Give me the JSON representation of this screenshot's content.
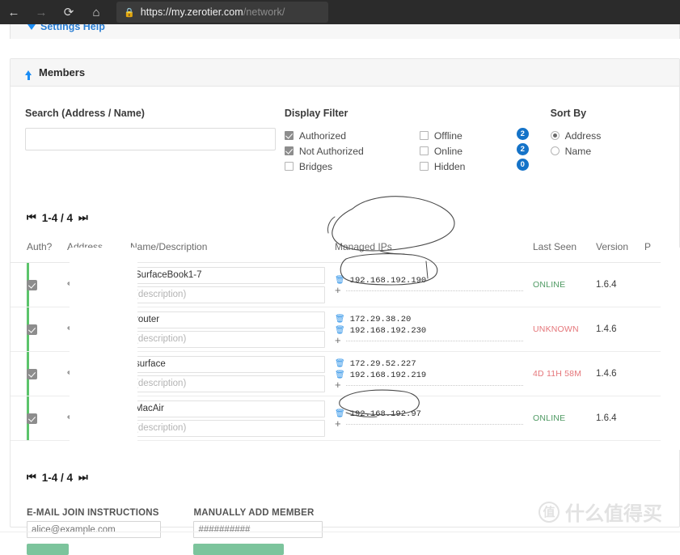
{
  "browser": {
    "back_icon": "←",
    "forward_icon": "→",
    "reload_icon": "⟳",
    "home_icon": "⌂",
    "lock_icon": "🔒",
    "url_host": "https://my.zerotier.com",
    "url_path": "/network/",
    "favorite_icon": "☆"
  },
  "settings_strip": {
    "help_label": "Settings Help"
  },
  "members": {
    "title": "Members"
  },
  "search": {
    "label": "Search (Address / Name)",
    "value": "",
    "placeholder": ""
  },
  "display_filter": {
    "title": "Display Filter",
    "options": [
      {
        "label": "Authorized",
        "checked": true
      },
      {
        "label": "Not Authorized",
        "checked": true
      },
      {
        "label": "Bridges",
        "checked": false
      }
    ],
    "status_options": [
      {
        "label": "Offline",
        "checked": false,
        "count": "2"
      },
      {
        "label": "Online",
        "checked": false,
        "count": "2"
      },
      {
        "label": "Hidden",
        "checked": false,
        "count": "0"
      }
    ]
  },
  "sort_by": {
    "title": "Sort By",
    "options": [
      {
        "label": "Address",
        "selected": true
      },
      {
        "label": "Name",
        "selected": false
      }
    ]
  },
  "pager": {
    "first_icon": "⏮",
    "last_icon": "⏭",
    "range": "1-4 / 4"
  },
  "table": {
    "headers": {
      "auth": "Auth?",
      "address": "Address",
      "name": "Name/Description",
      "ips": "Managed IPs",
      "last_seen": "Last Seen",
      "version": "Version",
      "physical": "P"
    },
    "rows": [
      {
        "authorized": true,
        "address": "",
        "name": "SurfaceBook1-7",
        "description_placeholder": "(description)",
        "ips": [
          "192.168.192.190"
        ],
        "last_seen": "ONLINE",
        "last_seen_state": "online",
        "version": "1.6.4"
      },
      {
        "authorized": true,
        "address": "",
        "name": "router",
        "description_placeholder": "(description)",
        "ips": [
          "172.29.38.20",
          "192.168.192.230"
        ],
        "last_seen": "UNKNOWN",
        "last_seen_state": "red",
        "version": "1.4.6"
      },
      {
        "authorized": true,
        "address": "",
        "name": "surface",
        "description_placeholder": "(description)",
        "ips": [
          "172.29.52.227",
          "192.168.192.219"
        ],
        "last_seen": "4D 11H 58M",
        "last_seen_state": "red",
        "version": "1.4.6"
      },
      {
        "authorized": true,
        "address": "",
        "name": "MacAir",
        "description_placeholder": "(description)",
        "ips": [
          "192.168.192.97"
        ],
        "last_seen": "ONLINE",
        "last_seen_state": "online",
        "version": "1.6.4"
      }
    ],
    "row_icons": {
      "delete_ip_icon": "🗑",
      "add_ip_icon": "+",
      "edit_icon": "✎"
    }
  },
  "footer_forms": {
    "email_join": {
      "label": "E-MAIL JOIN INSTRUCTIONS",
      "placeholder": "alice@example.com",
      "value": ""
    },
    "manual_add": {
      "label": "MANUALLY ADD MEMBER",
      "placeholder": "##########",
      "value": ""
    }
  },
  "watermark": {
    "badge": "值",
    "text": "什么值得买"
  },
  "colors": {
    "accent_blue": "#1573c8",
    "online_green": "#4f9a63",
    "alert_red": "#e5767a",
    "row_stripe": "#5cc46b"
  }
}
